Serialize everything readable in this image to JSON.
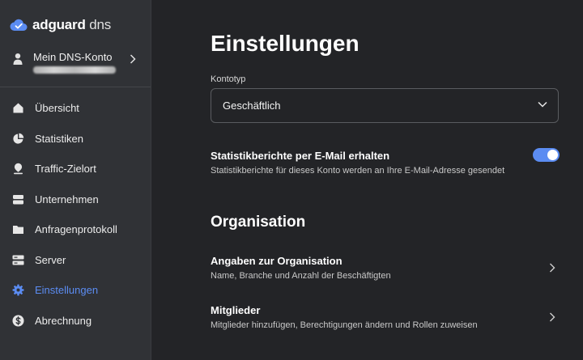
{
  "brand": {
    "name_bold": "adguard",
    "name_light": "dns"
  },
  "account": {
    "label": "Mein DNS-Konto"
  },
  "nav": {
    "items": [
      {
        "label": "Übersicht",
        "icon": "home-icon"
      },
      {
        "label": "Statistiken",
        "icon": "pie-chart-icon"
      },
      {
        "label": "Traffic-Zielort",
        "icon": "location-pin-icon"
      },
      {
        "label": "Unternehmen",
        "icon": "company-icon"
      },
      {
        "label": "Anfragenprotokoll",
        "icon": "folder-icon"
      },
      {
        "label": "Server",
        "icon": "server-icon"
      },
      {
        "label": "Einstellungen",
        "icon": "gear-icon",
        "active": true
      },
      {
        "label": "Abrechnung",
        "icon": "dollar-icon"
      }
    ]
  },
  "page": {
    "title": "Einstellungen",
    "account_type": {
      "label": "Kontotyp",
      "value": "Geschäftlich"
    },
    "stats_reports": {
      "title": "Statistikberichte per E-Mail erhalten",
      "description": "Statistikberichte für dieses Konto werden an Ihre E-Mail-Adresse gesendet",
      "enabled": true
    },
    "organisation": {
      "title": "Organisation",
      "rows": [
        {
          "title": "Angaben zur Organisation",
          "description": "Name, Branche und Anzahl der Beschäftigten"
        },
        {
          "title": "Mitglieder",
          "description": "Mitglieder hinzufügen, Berechtigungen ändern und Rollen zuweisen"
        }
      ]
    }
  },
  "colors": {
    "accent": "#5b8cf2",
    "sidebar_bg": "#303236",
    "main_bg": "#232427"
  }
}
